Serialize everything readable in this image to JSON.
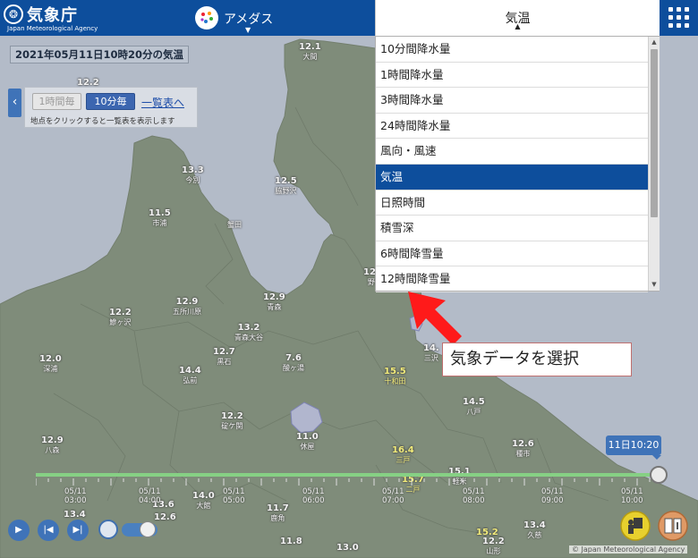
{
  "header": {
    "logo_mark": "JMA",
    "logo_title": "気象庁",
    "logo_subtitle": "Japan Meteorological Agency",
    "amedas_label": "アメダス",
    "element_tab_label": "気温"
  },
  "panel": {
    "date_title": "2021年05月11日10時20分の気温",
    "btn_hourly": "1時間毎",
    "btn_10min": "10分毎",
    "list_link": "一覧表へ",
    "hint": "地点をクリックすると一覧表を表示します"
  },
  "dropdown": {
    "items": [
      "10分間降水量",
      "1時間降水量",
      "3時間降水量",
      "24時間降水量",
      "風向・風速",
      "気温",
      "日照時間",
      "積雪深",
      "6時間降雪量",
      "12時間降雪量"
    ],
    "selected": "気温"
  },
  "annotation": {
    "callout": "気象データを選択"
  },
  "timeline": {
    "current": "11日10:20",
    "labels": [
      {
        "date": "05/11",
        "time": "03:00"
      },
      {
        "date": "05/11",
        "time": "04:00"
      },
      {
        "date": "05/11",
        "time": "05:00"
      },
      {
        "date": "05/11",
        "time": "06:00"
      },
      {
        "date": "05/11",
        "time": "07:00"
      },
      {
        "date": "05/11",
        "time": "08:00"
      },
      {
        "date": "05/11",
        "time": "09:00"
      },
      {
        "date": "05/11",
        "time": "10:00"
      }
    ]
  },
  "stations": [
    {
      "v": "12.1",
      "n": "大間"
    },
    {
      "v": "12.2",
      "n": ""
    },
    {
      "v": "13.3",
      "n": "今別"
    },
    {
      "v": "12.5",
      "n": "脇野沢"
    },
    {
      "v": "11.5",
      "n": "市浦"
    },
    {
      "v": "",
      "n": "蟹田"
    },
    {
      "v": "12.9",
      "n": "五所川原"
    },
    {
      "v": "12.9",
      "n": "青森"
    },
    {
      "v": "12.2",
      "n": "鰺ヶ沢"
    },
    {
      "v": "13.2",
      "n": "青森大谷"
    },
    {
      "v": "12.7",
      "n": "黒石"
    },
    {
      "v": "7.6",
      "n": "酸ヶ湯"
    },
    {
      "v": "12.0",
      "n": "深浦"
    },
    {
      "v": "14.4",
      "n": "弘前"
    },
    {
      "v": "15.5",
      "n": "十和田"
    },
    {
      "v": "14.",
      "n": "三沢"
    },
    {
      "v": "14.5",
      "n": "八戸"
    },
    {
      "v": "12.2",
      "n": "碇ケ関"
    },
    {
      "v": "11.0",
      "n": "休屋"
    },
    {
      "v": "12.9",
      "n": "八森"
    },
    {
      "v": "16.4",
      "n": "三戸"
    },
    {
      "v": "12.6",
      "n": "種市"
    },
    {
      "v": "15.1",
      "n": "軽米"
    },
    {
      "v": "15.7",
      "n": "二戸"
    },
    {
      "v": "14.0",
      "n": "大館"
    },
    {
      "v": "13.6",
      "n": ""
    },
    {
      "v": "13.4",
      "n": ""
    },
    {
      "v": "12.6",
      "n": ""
    },
    {
      "v": "11.7",
      "n": "鹿角"
    },
    {
      "v": "15.2",
      "n": ""
    },
    {
      "v": "13.4",
      "n": "久慈"
    },
    {
      "v": "12.2",
      "n": "山形"
    },
    {
      "v": "11.8",
      "n": ""
    },
    {
      "v": "13.0",
      "n": ""
    },
    {
      "v": "12.",
      "n": "野"
    }
  ],
  "colors": {
    "header": "#0d4e9c",
    "land": "#8c9a82",
    "sea": "#cbd4e1",
    "selected": "#0d4e9c",
    "track": "#86d084",
    "arrow": "#ff1a1a"
  },
  "copyright": "© Japan Meteorological Agency"
}
